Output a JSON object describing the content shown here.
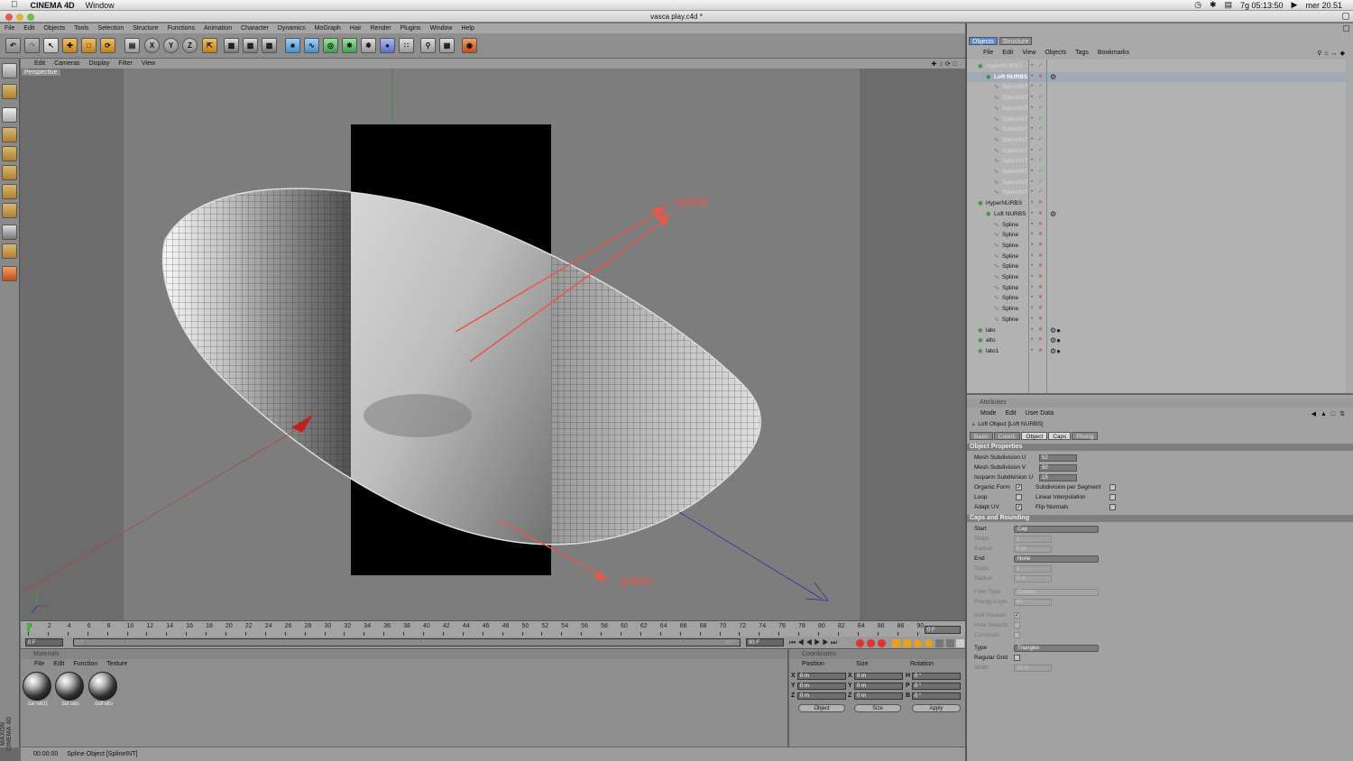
{
  "mac_menu": {
    "app_name": "CINEMA 4D",
    "window_menu": "Window",
    "clock_text": "7g 05:13:50",
    "datetime": "mer 20.51"
  },
  "window": {
    "title": "vasca play.c4d *"
  },
  "main_menu": [
    "File",
    "Edit",
    "Objects",
    "Tools",
    "Selection",
    "Structure",
    "Functions",
    "Animation",
    "Character",
    "Dynamics",
    "MoGraph",
    "Hair",
    "Render",
    "Plugins",
    "Window",
    "Help"
  ],
  "toolbar": {
    "x_label": "X",
    "y_label": "Y",
    "z_label": "Z"
  },
  "viewport": {
    "menu": [
      "Edit",
      "Cameras",
      "Display",
      "Filter",
      "View"
    ],
    "label": "Perspective",
    "annotation_top": "gobbe",
    "annotation_bottom": "gobbe",
    "annotation_color": "#e8574a"
  },
  "timeline": {
    "ticks": [
      "0",
      "2",
      "4",
      "6",
      "8",
      "10",
      "12",
      "14",
      "16",
      "18",
      "20",
      "22",
      "24",
      "26",
      "28",
      "30",
      "32",
      "34",
      "36",
      "38",
      "40",
      "42",
      "44",
      "46",
      "48",
      "50",
      "52",
      "54",
      "56",
      "58",
      "60",
      "62",
      "64",
      "66",
      "68",
      "70",
      "72",
      "74",
      "76",
      "78",
      "80",
      "82",
      "84",
      "86",
      "88",
      "90"
    ],
    "current_frame": "0 F",
    "start_frame": "0 F",
    "range_start": "0 F",
    "range_end": "90 F",
    "end_frame": "90 F"
  },
  "materials": {
    "header": "Materials",
    "menu": [
      "File",
      "Edit",
      "Function",
      "Texture"
    ],
    "items": [
      "dal lato1",
      "dal lato",
      "dall'alto"
    ]
  },
  "coordinates": {
    "header": "Coordinates",
    "col_position": "Position",
    "col_size": "Size",
    "col_rotation": "Rotation",
    "axes": [
      "X",
      "Y",
      "Z"
    ],
    "rot_axes": [
      "H",
      "P",
      "B"
    ],
    "positions": [
      "0 m",
      "0 m",
      "0 m"
    ],
    "sizes": [
      "0 m",
      "0 m",
      "0 m"
    ],
    "rotations": [
      "0 °",
      "0 °",
      "0 °"
    ],
    "mode_object": "Object",
    "mode_size": "Size",
    "apply": "Apply"
  },
  "status": {
    "time": "00:00:00",
    "message": "Spline Object [SplineINT]"
  },
  "maxon_logo": "MAXON CINEMA 4D",
  "object_manager": {
    "tabs": [
      "Objects",
      "Structure"
    ],
    "menu": [
      "File",
      "Edit",
      "View",
      "Objects",
      "Tags",
      "Bookmarks"
    ],
    "rows": [
      {
        "name": "HyperNURBS",
        "indent": 0,
        "dim": true
      },
      {
        "name": "Loft NURBS",
        "indent": 1,
        "dim": false,
        "selected": true
      },
      {
        "name": "SplineINT",
        "indent": 2,
        "dim": true
      },
      {
        "name": "SplineINT",
        "indent": 2,
        "dim": true
      },
      {
        "name": "SplineINT",
        "indent": 2,
        "dim": true
      },
      {
        "name": "SplineINT",
        "indent": 2,
        "dim": true
      },
      {
        "name": "SplineINT",
        "indent": 2,
        "dim": true
      },
      {
        "name": "SplineINT",
        "indent": 2,
        "dim": true
      },
      {
        "name": "SplineINT",
        "indent": 2,
        "dim": true
      },
      {
        "name": "SplineINT",
        "indent": 2,
        "dim": true
      },
      {
        "name": "SplineINT",
        "indent": 2,
        "dim": true
      },
      {
        "name": "SplineINT",
        "indent": 2,
        "dim": true
      },
      {
        "name": "SplineINT",
        "indent": 2,
        "dim": true
      },
      {
        "name": "HyperNURBS",
        "indent": 0,
        "dim": false
      },
      {
        "name": "Loft NURBS",
        "indent": 1,
        "dim": false
      },
      {
        "name": "Spline",
        "indent": 2,
        "dim": false
      },
      {
        "name": "Spline",
        "indent": 2,
        "dim": false
      },
      {
        "name": "Spline",
        "indent": 2,
        "dim": false
      },
      {
        "name": "Spline",
        "indent": 2,
        "dim": false
      },
      {
        "name": "Spline",
        "indent": 2,
        "dim": false
      },
      {
        "name": "Spline",
        "indent": 2,
        "dim": false
      },
      {
        "name": "Spline",
        "indent": 2,
        "dim": false
      },
      {
        "name": "Spline",
        "indent": 2,
        "dim": false
      },
      {
        "name": "Spline",
        "indent": 2,
        "dim": false
      },
      {
        "name": "Spline",
        "indent": 2,
        "dim": false
      },
      {
        "name": "lato",
        "indent": 0,
        "dim": false
      },
      {
        "name": "alto",
        "indent": 0,
        "dim": false
      },
      {
        "name": "lato1",
        "indent": 0,
        "dim": false
      }
    ]
  },
  "attributes": {
    "header": "Attributes",
    "menu": [
      "Mode",
      "Edit",
      "User Data"
    ],
    "object_title": "Loft Object [Loft NURBS]",
    "tabs": [
      "Basic",
      "Coord.",
      "Object",
      "Caps",
      "Phong"
    ],
    "selected_tab": "Object",
    "section_object": "Object Properties",
    "mesh_u_label": "Mesh Subdivision U",
    "mesh_u": "52",
    "mesh_v_label": "Mesh Subdivision V",
    "mesh_v": "50",
    "iso_u_label": "Isoparm Subdivision U",
    "iso_u": "15",
    "organic_label": "Organic Form",
    "subdiv_seg_label": "Subdivision per Segment",
    "loop_label": "Loop",
    "linear_interp_label": "Linear Interpolation",
    "adapt_uv_label": "Adapt UV",
    "flip_normals_label": "Flip Normals",
    "section_caps": "Caps and Rounding",
    "start_label": "Start",
    "start_value": "Cap",
    "steps_label": "Steps",
    "steps_value": "1",
    "radius_label": "Radius",
    "radius_value": "5 m",
    "end_label": "End",
    "end_value": "None",
    "steps2_value": "1",
    "radius2_value": "5 m",
    "fillet_label": "Fillet Type",
    "fillet_value": "Convex",
    "phong_label": "Phong Angle",
    "phong_value": "60 °",
    "hull_label": "Hull Inwards",
    "hole_label": "Hole Inwards",
    "constrain_label": "Constrain",
    "type_label": "Type",
    "type_value": "Triangles",
    "regular_grid_label": "Regular Grid",
    "width_label": "Width",
    "width_value": "10 m"
  },
  "colors": {
    "selection_accent": "#3a7fd0",
    "timeline_marker": "#30c030"
  }
}
